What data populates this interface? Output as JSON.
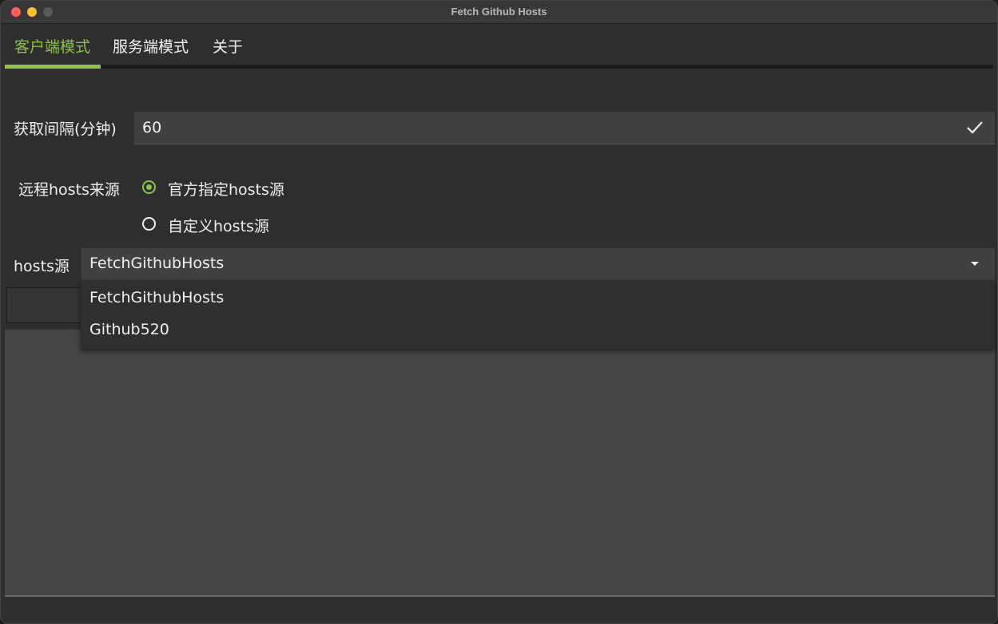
{
  "window": {
    "title": "Fetch Github Hosts"
  },
  "tabs": [
    {
      "label": "客户端模式",
      "active": true
    },
    {
      "label": "服务端模式",
      "active": false
    },
    {
      "label": "关于",
      "active": false
    }
  ],
  "form": {
    "interval_label": "获取间隔(分钟)",
    "interval_value": "60",
    "source_label": "远程hosts来源",
    "radio_options": [
      {
        "label": "官方指定hosts源",
        "selected": true
      },
      {
        "label": "自定义hosts源",
        "selected": false
      }
    ],
    "hosts_label": "hosts源",
    "hosts_selected": "FetchGithubHosts",
    "hosts_options": [
      "FetchGithubHosts",
      "Github520"
    ]
  },
  "colors": {
    "accent": "#8bc34a",
    "background": "#2e2e2e",
    "field": "#414141"
  }
}
